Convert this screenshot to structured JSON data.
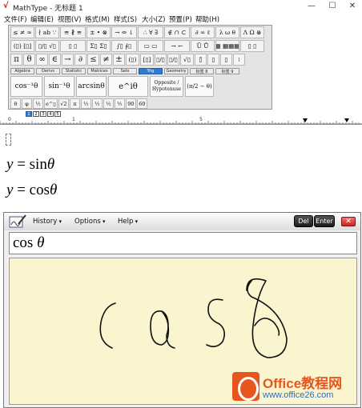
{
  "window": {
    "app_title": "MathType - 无标题 1",
    "logo": "√",
    "controls": [
      "—",
      "☐",
      "✕"
    ]
  },
  "menu": [
    "文件(F)",
    "编辑(E)",
    "视图(V)",
    "格式(M)",
    "样式(S)",
    "大小(Z)",
    "预置(P)",
    "帮助(H)"
  ],
  "palette": {
    "row1": [
      "≤ ≠ ≈",
      "∤ ab ∵",
      "≡ ∦ ≡",
      "± • ⊗",
      "→ ⇔ ↓",
      "∴ ∀ ∃",
      "∉ ∩ ⊂",
      "∂ ∞ ℓ",
      "λ ω θ",
      "Λ Ω ⊛"
    ],
    "row2": [
      "(▯) [▯]",
      "▯/▯ √▯",
      "▯ ▯",
      "Σ▯ Σ▯",
      "∫▯ ∮▯",
      "▭ ▭",
      "→ ←",
      "Ū Ů",
      "▦ ▦▦▦",
      "▯ ▯"
    ],
    "row3": [
      "π",
      "θ",
      "∞",
      "∈",
      "→",
      "∂",
      "≤",
      "≠",
      "±",
      "(▯)",
      "[▯]",
      "▯/▯",
      "▯/▯",
      "√▯",
      "▯̄",
      "▯",
      "▯",
      "⁞"
    ],
    "tabs": [
      "Algebra",
      "Derivs",
      "Statistic",
      "Matrices",
      "Sets",
      "Trig",
      "Geometry",
      "标签 8",
      "标签 9"
    ],
    "active_tab": "Trig",
    "templates": [
      "cos⁻¹θ",
      "sin⁻¹θ",
      "arcsinθ",
      "e^iθ",
      "Opposite / Hypotenuse",
      "(π/2 − θ)"
    ],
    "small_row": [
      "θ",
      "φ",
      "½",
      "e^▯",
      "√2",
      "π",
      "½",
      "½",
      "½",
      "½",
      "90",
      "60"
    ],
    "size_tabs": [
      "1",
      "2",
      "3",
      "4",
      "5"
    ]
  },
  "ruler": {
    "marks": [
      "0",
      "1",
      "5"
    ]
  },
  "document": {
    "equation1": {
      "lhs": "y",
      "eq": "=",
      "fn": "sin",
      "var": "θ"
    },
    "equation2": {
      "lhs": "y",
      "eq": "=",
      "fn": "cos",
      "var": "θ"
    }
  },
  "math_input_panel": {
    "menus": [
      "History",
      "Options",
      "Help"
    ],
    "del_label": "Del",
    "enter_label": "Enter",
    "close_label": "✕",
    "preview": {
      "fn": "cos",
      "var": "θ"
    },
    "handwriting_strokes": "cos θ"
  },
  "watermark": {
    "title": "Office教程网",
    "url": "www.office26.com"
  },
  "colors": {
    "accent": "#2f7bd1",
    "pad_bg": "#fbf5cf",
    "watermark_orange": "#e8561f",
    "watermark_blue": "#2b6cc4"
  }
}
